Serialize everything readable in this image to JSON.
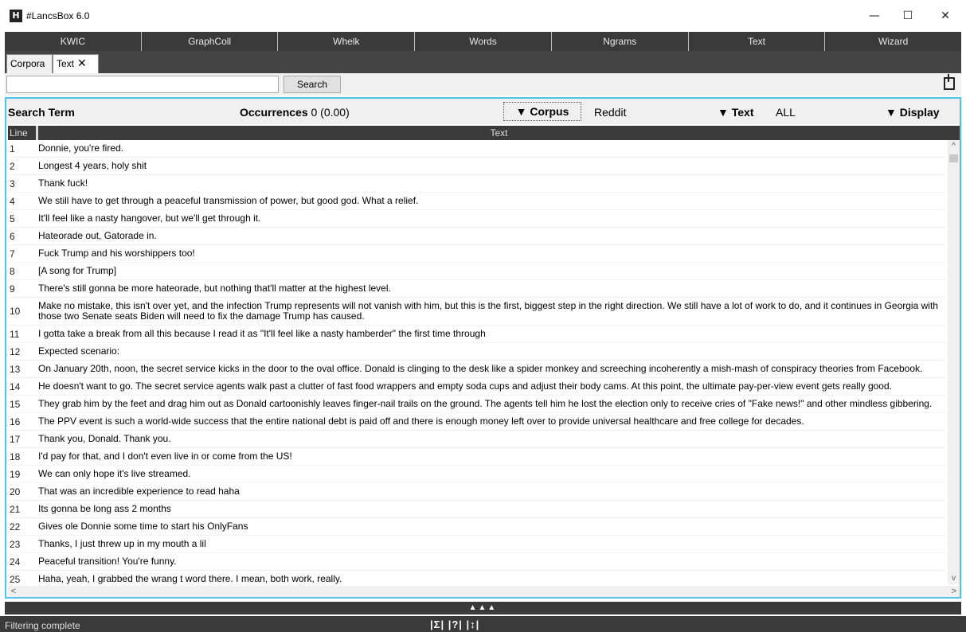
{
  "window": {
    "title": "#LancsBox 6.0",
    "controls": {
      "minimize": "—",
      "maximize": "☐",
      "close": "✕"
    }
  },
  "nav": [
    "KWIC",
    "GraphColl",
    "Whelk",
    "Words",
    "Ngrams",
    "Text",
    "Wizard"
  ],
  "tabs": {
    "corpora": "Corpora",
    "text": "Text",
    "close": "✕"
  },
  "search": {
    "value": "",
    "placeholder": "",
    "button": "Search"
  },
  "header": {
    "search_term": "Search Term",
    "occurrences_label": "Occurrences",
    "occurrences_value": "0 (0.00)",
    "corpus_label": "▼ Corpus",
    "corpus_value": "Reddit",
    "text_label": "▼ Text",
    "text_value": "ALL",
    "display_label": "▼ Display"
  },
  "table": {
    "columns": [
      "Line",
      "Text"
    ],
    "rows": [
      {
        "line": "1",
        "text": "Donnie, you're fired."
      },
      {
        "line": "2",
        "text": "Longest 4 years, holy shit"
      },
      {
        "line": "3",
        "text": "Thank fuck!"
      },
      {
        "line": "4",
        "text": "We still have to get through a peaceful transmission of power, but good god. What a relief."
      },
      {
        "line": "5",
        "text": "It'll feel like a nasty hangover, but we'll get through it."
      },
      {
        "line": "6",
        "text": "Hateorade out, Gatorade in."
      },
      {
        "line": "7",
        "text": "Fuck Trump and his worshippers too!"
      },
      {
        "line": "8",
        "text": "[A song for Trump]"
      },
      {
        "line": "9",
        "text": "There's still gonna be more hateorade, but nothing that'll matter at the highest level."
      },
      {
        "line": "10",
        "text": "Make no mistake, this isn't over yet, and the infection Trump represents will not vanish with him, but this is the first, biggest step in the right direction. We still have a lot of work to do, and it continues in Georgia with those two Senate seats Biden will need to fix the damage Trump has caused."
      },
      {
        "line": "11",
        "text": "I gotta take a break from all this because I read it as \"It'll feel like a nasty hamberder\" the first time through"
      },
      {
        "line": "12",
        "text": "Expected scenario:"
      },
      {
        "line": "13",
        "text": "On January 20th, noon, the secret service kicks in the door to the oval office. Donald is clinging to the desk like a spider monkey and screeching incoherently a mish-mash of conspiracy theories from Facebook."
      },
      {
        "line": "14",
        "text": "He doesn't want to go. The secret service agents walk past a clutter of fast food wrappers and empty soda cups and adjust their body cams. At this point, the ultimate pay-per-view event gets really good."
      },
      {
        "line": "15",
        "text": "They grab him by the feet and drag him out as Donald cartoonishly leaves finger-nail trails on the ground. The agents tell him he lost the election only to receive cries of \"Fake news!\" and other mindless gibbering."
      },
      {
        "line": "16",
        "text": "The PPV event is such a world-wide success that the entire national debt is paid off and there is enough money left over to provide universal healthcare and free college for decades."
      },
      {
        "line": "17",
        "text": "Thank you, Donald. Thank you."
      },
      {
        "line": "18",
        "text": "I'd pay for that, and I don't even live in or come from the US!"
      },
      {
        "line": "19",
        "text": "We can only hope it's live streamed."
      },
      {
        "line": "20",
        "text": "That was an incredible experience to read haha"
      },
      {
        "line": "21",
        "text": "Its gonna be long ass 2 months"
      },
      {
        "line": "22",
        "text": "Gives ole Donnie some time to start his OnlyFans"
      },
      {
        "line": "23",
        "text": "Thanks, I just threw up in my mouth a lil"
      },
      {
        "line": "24",
        "text": "Peaceful transition! You're funny."
      },
      {
        "line": "25",
        "text": "Haha, yeah, I grabbed the wrang t word there. I mean, both work, really."
      }
    ]
  },
  "collapse": "▲▲▲",
  "status": {
    "text": "Filtering complete",
    "icons": "|Σ| |?| |↕|"
  }
}
